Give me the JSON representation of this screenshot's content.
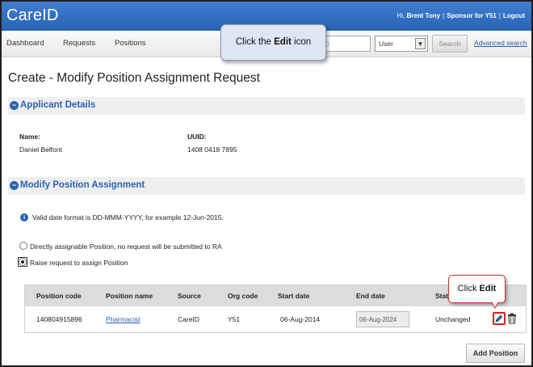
{
  "app": {
    "logo": "CareID",
    "greeting": "Hi,",
    "user_name": "Brent Tony",
    "sponsor_label": "Sponsor for Y51",
    "logout": "Logout",
    "link_separator": "|"
  },
  "nav": {
    "items": [
      "Dashboard",
      "Requests",
      "Positions"
    ],
    "search_partial": "D",
    "select_value": "User",
    "search_button": "Search",
    "advanced_search": "Advanced search"
  },
  "callouts": {
    "top_prefix": "Click the ",
    "top_bold": "Edit",
    "top_suffix": " icon",
    "right_prefix": "Click ",
    "right_bold": "Edit"
  },
  "page": {
    "title": "Create - Modify Position Assignment Request"
  },
  "applicant": {
    "section_title": "Applicant Details",
    "name_label": "Name:",
    "name_value": "Daniel Belfont",
    "uuid_label": "UUID:",
    "uuid_value": "1408 0418 7895"
  },
  "modify": {
    "section_title": "Modify Position Assignment",
    "info": "Valid date format is DD-MMM-YYYY, for example 12-Jun-2015.",
    "option_direct": "Directly assignable Position, no request will be submitted to RA",
    "option_raise": "Raise request to assign Position"
  },
  "table": {
    "headers": [
      "Position code",
      "Position name",
      "Source",
      "Org code",
      "Start date",
      "End date",
      "Stat"
    ],
    "rows": [
      {
        "position_code": "140804915896",
        "position_name": "Pharmacist",
        "source": "CareID",
        "org_code": "Y51",
        "start_date": "06-Aug-2014",
        "end_date": "06-Aug-2024",
        "status": "Unchanged"
      }
    ]
  },
  "actions": {
    "add_position": "Add Position"
  },
  "colors": {
    "brand_blue": "#2a62b3",
    "edit_highlight": "#d9261c"
  },
  "icons": [
    "collapse-circle-icon",
    "info-icon",
    "edit-pencil-icon",
    "trash-icon",
    "dropdown-arrow-icon"
  ]
}
